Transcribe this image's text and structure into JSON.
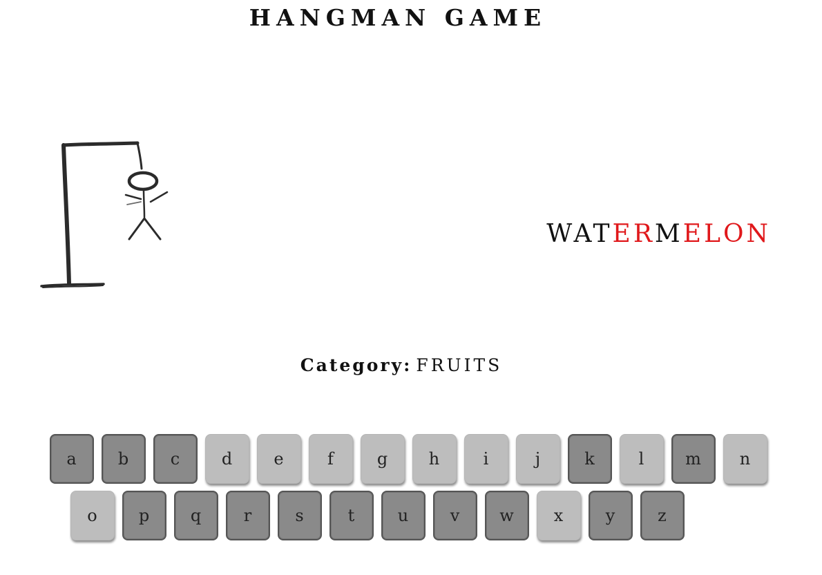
{
  "title": "HANGMAN GAME",
  "word": {
    "letters": [
      {
        "char": "W",
        "missed": false
      },
      {
        "char": "A",
        "missed": false
      },
      {
        "char": "T",
        "missed": false
      },
      {
        "char": "E",
        "missed": true
      },
      {
        "char": "R",
        "missed": true
      },
      {
        "char": "M",
        "missed": false
      },
      {
        "char": "E",
        "missed": true
      },
      {
        "char": "L",
        "missed": true
      },
      {
        "char": "O",
        "missed": true
      },
      {
        "char": "N",
        "missed": true
      }
    ],
    "correct_color": "#111111",
    "missed_color": "#e0181b"
  },
  "category": {
    "label": "Category:",
    "value": "FRUITS"
  },
  "keyboard": {
    "rows": [
      [
        {
          "letter": "a",
          "used": true
        },
        {
          "letter": "b",
          "used": true
        },
        {
          "letter": "c",
          "used": true
        },
        {
          "letter": "d",
          "used": false
        },
        {
          "letter": "e",
          "used": false
        },
        {
          "letter": "f",
          "used": false
        },
        {
          "letter": "g",
          "used": false
        },
        {
          "letter": "h",
          "used": false
        },
        {
          "letter": "i",
          "used": false
        },
        {
          "letter": "j",
          "used": false
        },
        {
          "letter": "k",
          "used": true
        },
        {
          "letter": "l",
          "used": false
        },
        {
          "letter": "m",
          "used": true
        },
        {
          "letter": "n",
          "used": false
        }
      ],
      [
        {
          "letter": "o",
          "used": false
        },
        {
          "letter": "p",
          "used": true
        },
        {
          "letter": "q",
          "used": true
        },
        {
          "letter": "r",
          "used": true
        },
        {
          "letter": "s",
          "used": true
        },
        {
          "letter": "t",
          "used": true
        },
        {
          "letter": "u",
          "used": true
        },
        {
          "letter": "v",
          "used": true
        },
        {
          "letter": "w",
          "used": true
        },
        {
          "letter": "x",
          "used": false
        },
        {
          "letter": "y",
          "used": true
        },
        {
          "letter": "z",
          "used": true
        }
      ]
    ],
    "used_color": "#8a8a8a",
    "unused_color": "#bdbdbd"
  },
  "hangman": {
    "stage": "complete-figure",
    "icon": "gallows-with-hanged-stick-figure"
  }
}
